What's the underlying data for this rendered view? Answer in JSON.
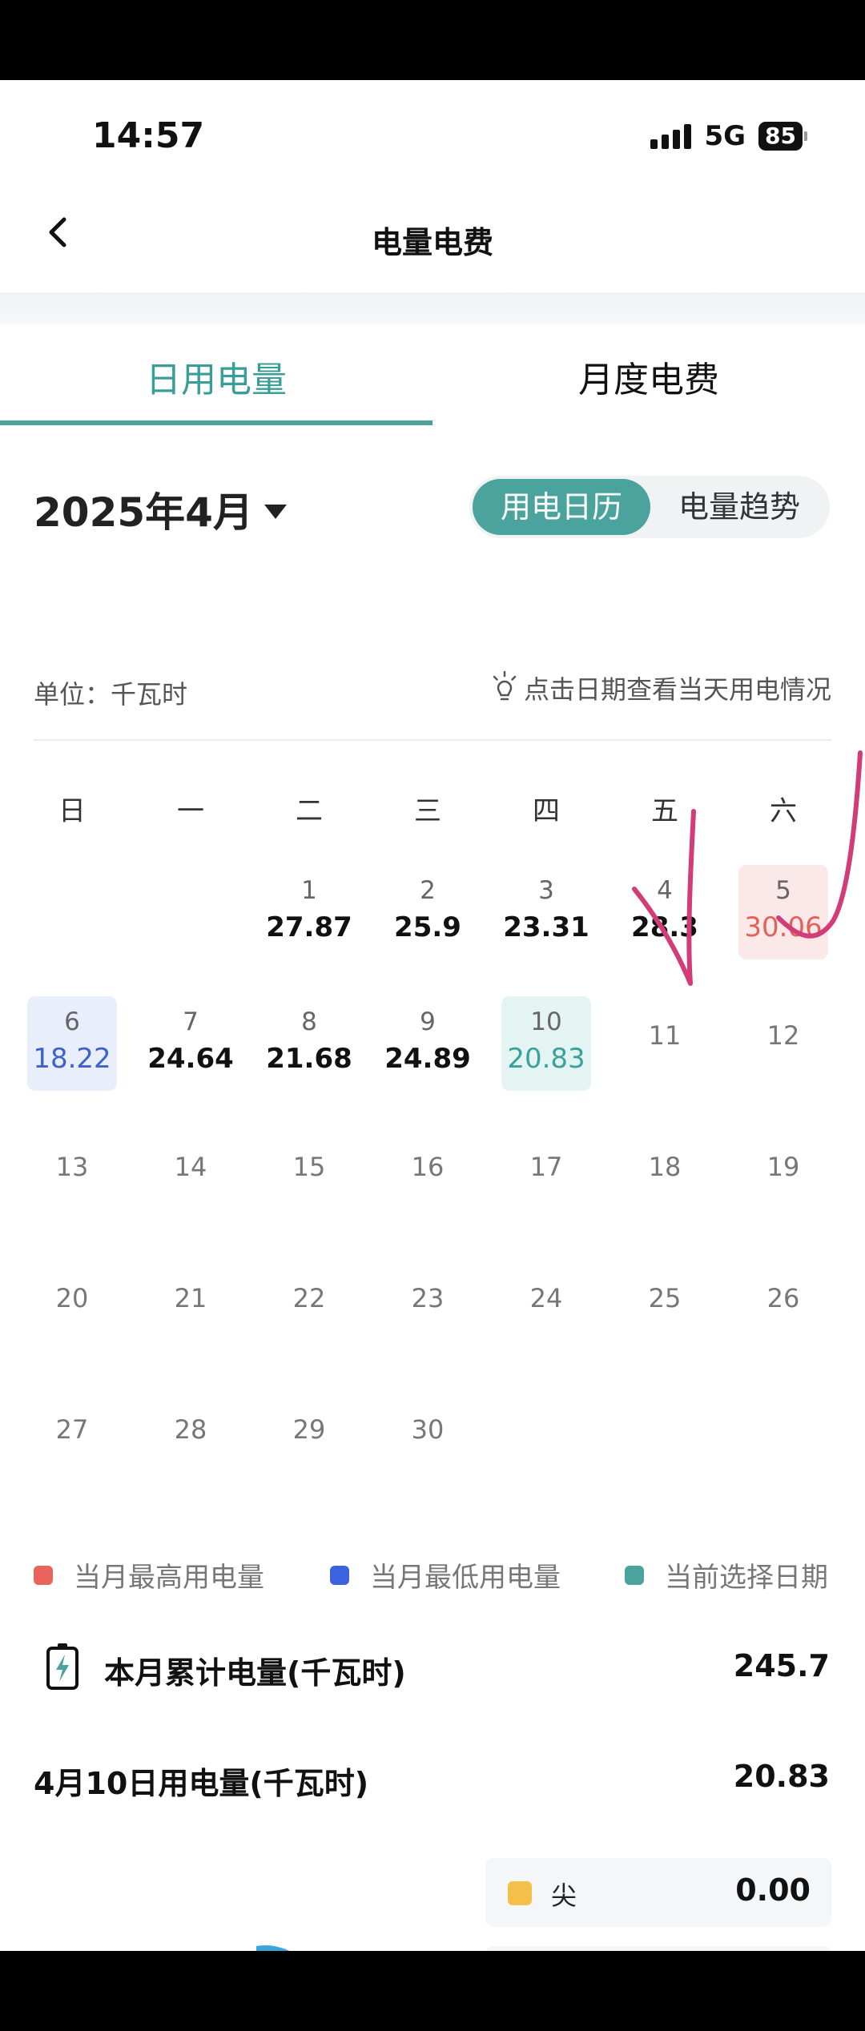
{
  "status": {
    "time": "14:57",
    "network": "5G",
    "battery": "85"
  },
  "header": {
    "title": "电量电费"
  },
  "tabs": [
    {
      "label": "日用电量",
      "active": true
    },
    {
      "label": "月度电费",
      "active": false
    }
  ],
  "month": {
    "label": "2025年4月"
  },
  "segment": {
    "calendar": "用电日历",
    "trend": "电量趋势"
  },
  "unit_label": "单位：千瓦时",
  "hint": "点击日期查看当天用电情况",
  "weekdays": [
    "日",
    "一",
    "二",
    "三",
    "四",
    "五",
    "六"
  ],
  "calendar": {
    "days": [
      {
        "day": "1",
        "value": "27.87"
      },
      {
        "day": "2",
        "value": "25.9"
      },
      {
        "day": "3",
        "value": "23.31"
      },
      {
        "day": "4",
        "value": "28.3"
      },
      {
        "day": "5",
        "value": "30.06",
        "state": "max"
      },
      {
        "day": "6",
        "value": "18.22",
        "state": "min"
      },
      {
        "day": "7",
        "value": "24.64"
      },
      {
        "day": "8",
        "value": "21.68"
      },
      {
        "day": "9",
        "value": "24.89"
      },
      {
        "day": "10",
        "value": "20.83",
        "state": "selected"
      },
      {
        "day": "11"
      },
      {
        "day": "12"
      },
      {
        "day": "13"
      },
      {
        "day": "14"
      },
      {
        "day": "15"
      },
      {
        "day": "16"
      },
      {
        "day": "17"
      },
      {
        "day": "18"
      },
      {
        "day": "19"
      },
      {
        "day": "20"
      },
      {
        "day": "21"
      },
      {
        "day": "22"
      },
      {
        "day": "23"
      },
      {
        "day": "24"
      },
      {
        "day": "25"
      },
      {
        "day": "26"
      },
      {
        "day": "27"
      },
      {
        "day": "28"
      },
      {
        "day": "29"
      },
      {
        "day": "30"
      }
    ]
  },
  "legend": {
    "max": {
      "label": "当月最高用电量",
      "color": "#e8645c"
    },
    "min": {
      "label": "当月最低用电量",
      "color": "#3d62e0"
    },
    "selected": {
      "label": "当前选择日期",
      "color": "#4aa39d"
    }
  },
  "summary": {
    "month_total_label": "本月累计电量(千瓦时)",
    "month_total_value": "245.7",
    "day_label": "4月10日用电量(千瓦时)",
    "day_value": "20.83"
  },
  "breakdown": [
    {
      "label": "尖",
      "value": "0.00",
      "color": "#f5c04a"
    }
  ],
  "colors": {
    "accent": "#4aa39d",
    "annotation": "#d23c78"
  },
  "icons": [
    "back-chevron-icon",
    "signal-icon",
    "battery-status-icon",
    "caret-down-icon",
    "bulb-icon",
    "battery-charge-icon"
  ]
}
